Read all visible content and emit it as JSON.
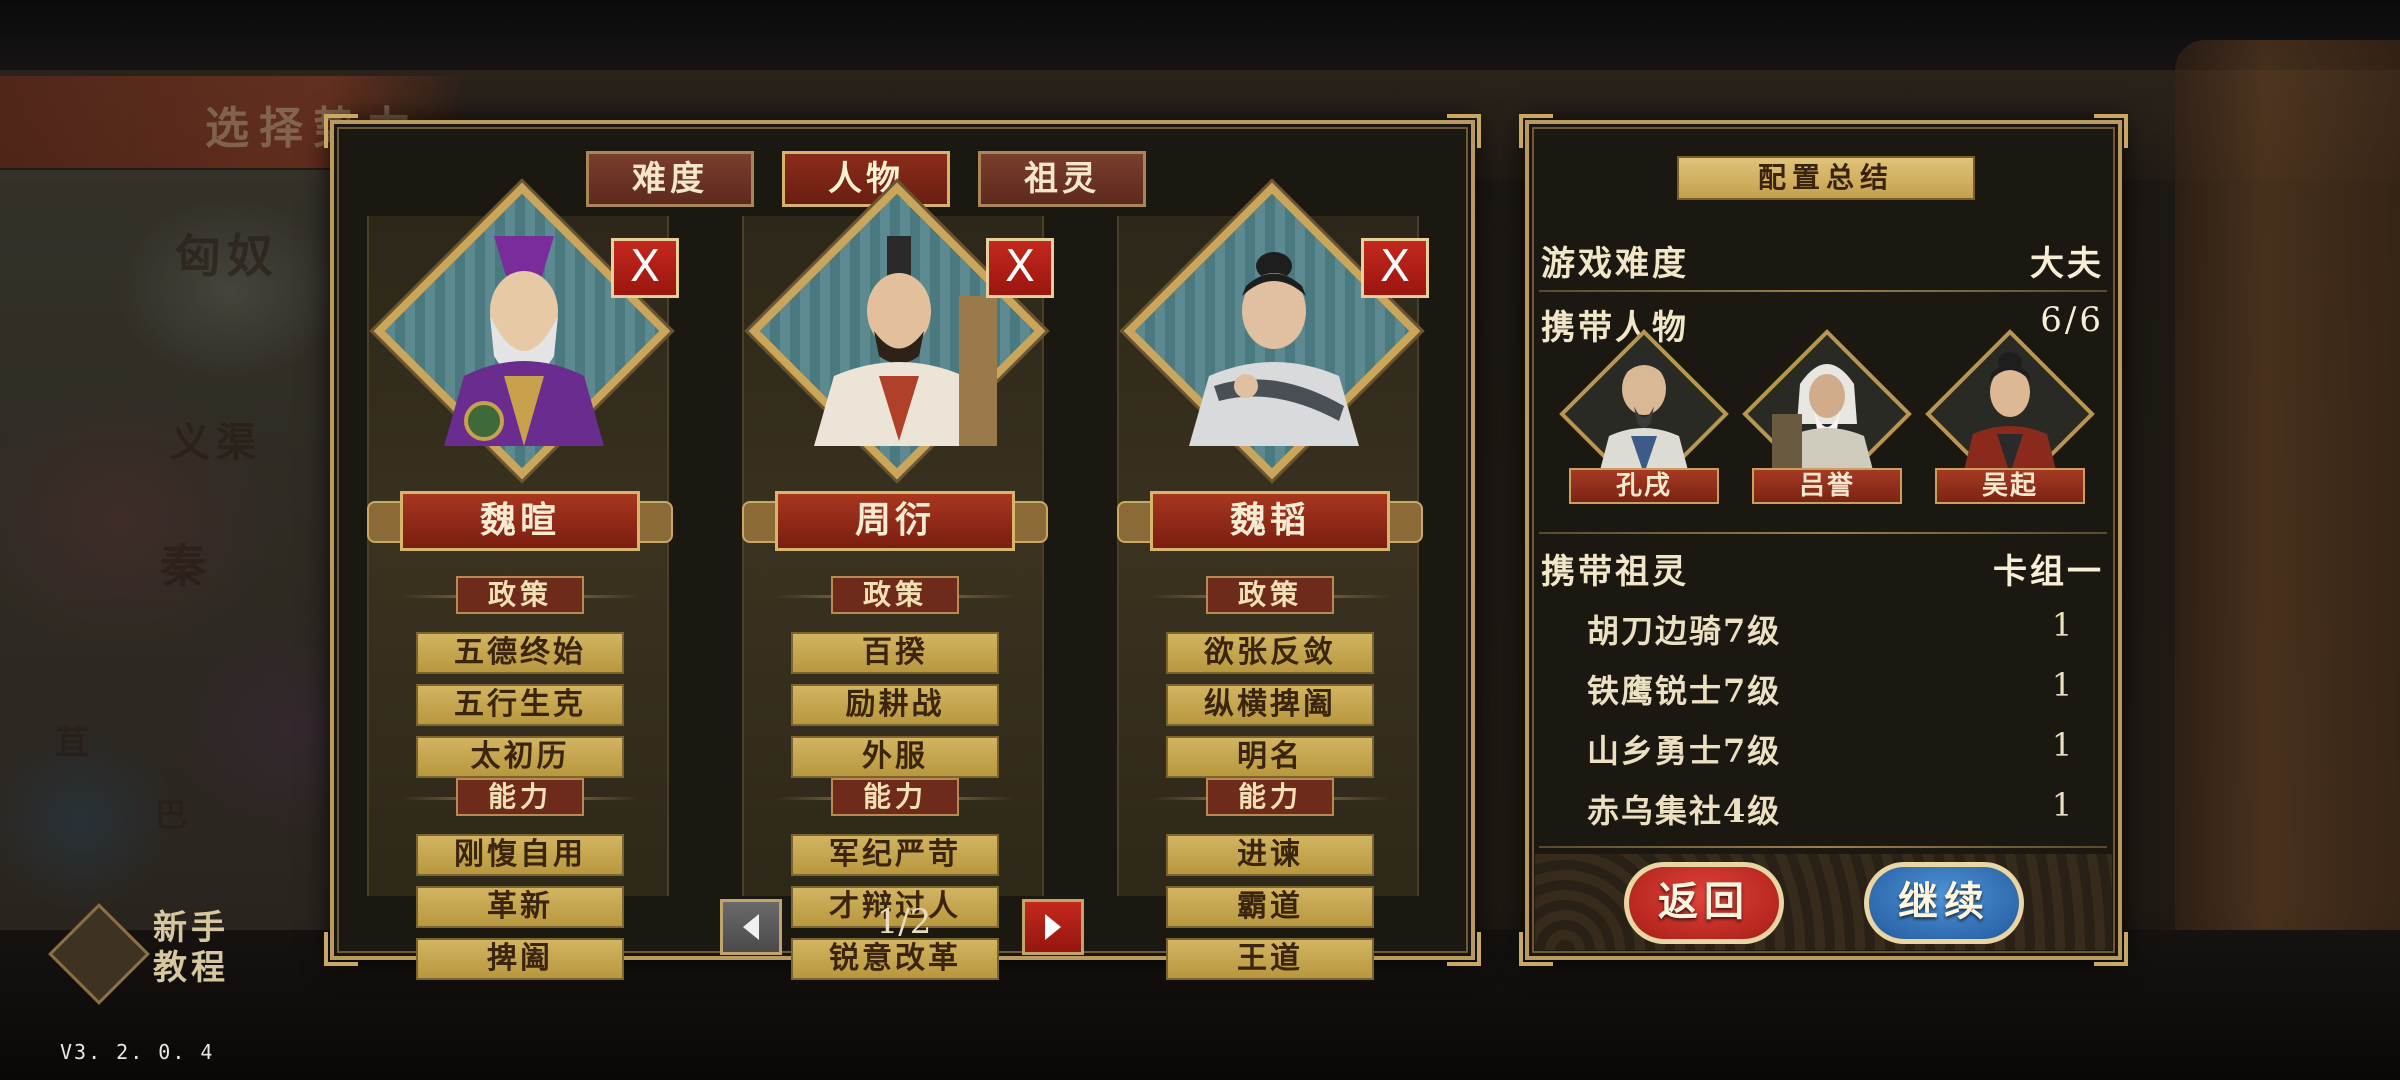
{
  "background": {
    "page_title": "选择势力",
    "map_labels": [
      "匈奴",
      "义渠",
      "秦",
      "苴",
      "巴"
    ]
  },
  "tutorial": {
    "line1": "新手",
    "line2": "教程"
  },
  "version": "V3. 2. 0. 4",
  "tabs": [
    {
      "label": "难度",
      "active": false
    },
    {
      "label": "人物",
      "active": true
    },
    {
      "label": "祖灵",
      "active": false
    }
  ],
  "characters": [
    {
      "name": "魏暄",
      "close": "X",
      "policy_header": "政策",
      "policies": [
        "五德终始",
        "五行生克",
        "太初历"
      ],
      "ability_header": "能力",
      "abilities": [
        "刚愎自用",
        "革新",
        "捭阖"
      ]
    },
    {
      "name": "周衍",
      "close": "X",
      "policy_header": "政策",
      "policies": [
        "百揆",
        "励耕战",
        "外服"
      ],
      "ability_header": "能力",
      "abilities": [
        "军纪严苛",
        "才辩过人",
        "锐意改革"
      ]
    },
    {
      "name": "魏韬",
      "close": "X",
      "policy_header": "政策",
      "policies": [
        "欲张反敛",
        "纵横捭阖",
        "明名"
      ],
      "ability_header": "能力",
      "abilities": [
        "进谏",
        "霸道",
        "王道"
      ]
    }
  ],
  "pager": {
    "text": "1/2",
    "prev_icon": "arrow-left-icon",
    "next_icon": "arrow-right-icon"
  },
  "summary": {
    "title": "配置总结",
    "difficulty_label": "游戏难度",
    "difficulty_value": "大夫",
    "characters_label": "携带人物",
    "characters_count": "6/6",
    "heroes": [
      "孔戌",
      "吕誉",
      "吴起"
    ],
    "spirits_label": "携带祖灵",
    "spirits_deck": "卡组一",
    "spirits": [
      {
        "name": "胡刀边骑7级",
        "count": "1"
      },
      {
        "name": "铁鹰锐士7级",
        "count": "1"
      },
      {
        "name": "山乡勇士7级",
        "count": "1"
      },
      {
        "name": "赤乌集社4级",
        "count": "1"
      }
    ],
    "back_label": "返回",
    "continue_label": "继续"
  },
  "colors": {
    "accent_red": "#9a1e12",
    "accent_gold": "#c9a864",
    "continue_blue": "#2f6fb6",
    "back_red": "#c0302a"
  }
}
